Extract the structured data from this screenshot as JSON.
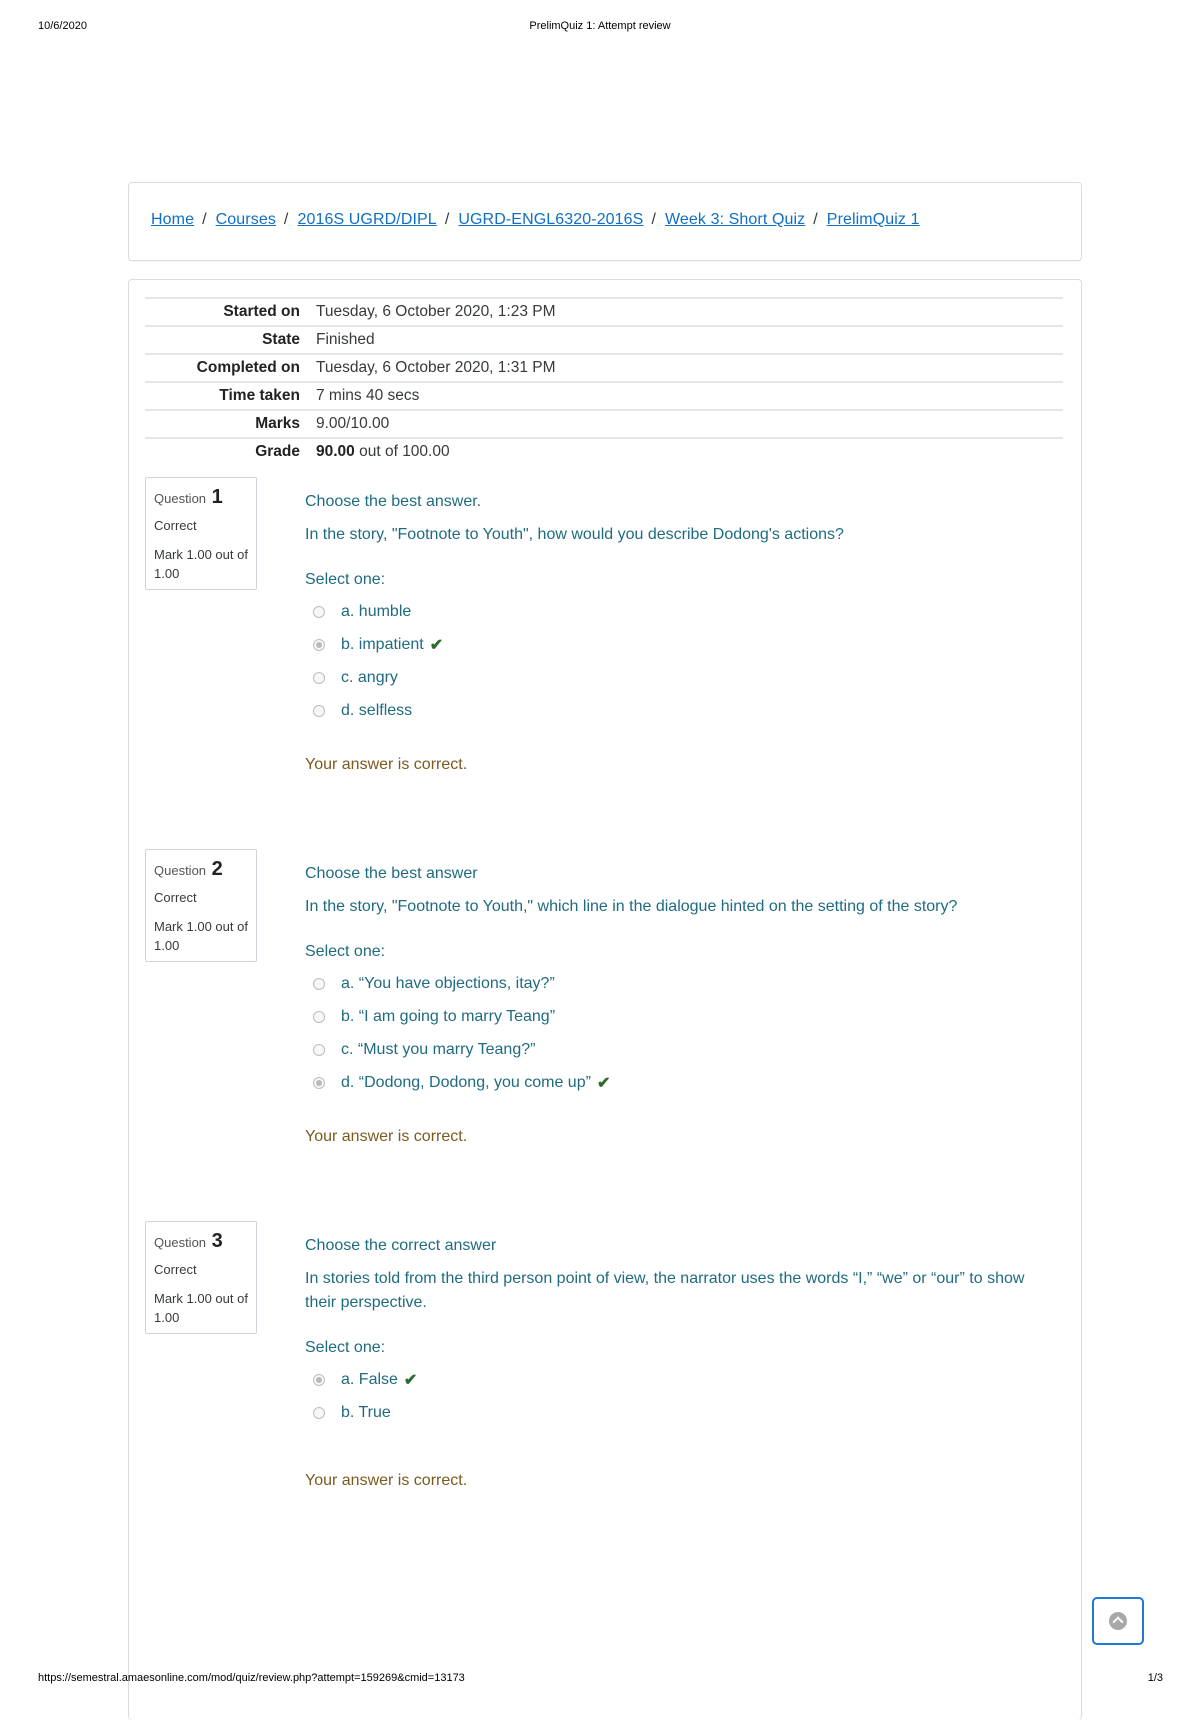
{
  "print_header": {
    "date": "10/6/2020",
    "title": "PrelimQuiz 1: Attempt review"
  },
  "print_footer": {
    "url": "https://semestral.amaesonline.com/mod/quiz/review.php?attempt=159269&cmid=13173",
    "page": "1/3"
  },
  "breadcrumb": {
    "separator": "/",
    "items": [
      {
        "label": "Home"
      },
      {
        "label": "Courses"
      },
      {
        "label": "2016S UGRD/DIPL"
      },
      {
        "label": "UGRD-ENGL6320-2016S"
      },
      {
        "label": "Week 3: Short Quiz"
      },
      {
        "label": "PrelimQuiz 1"
      }
    ]
  },
  "summary": {
    "rows": [
      {
        "label": "Started on",
        "value": "Tuesday, 6 October 2020, 1:23 PM"
      },
      {
        "label": "State",
        "value": "Finished"
      },
      {
        "label": "Completed on",
        "value": "Tuesday, 6 October 2020, 1:31 PM"
      },
      {
        "label": "Time taken",
        "value": "7 mins 40 secs"
      },
      {
        "label": "Marks",
        "value": "9.00/10.00"
      },
      {
        "label": "Grade",
        "value_bold": "90.00",
        "value": " out of 100.00"
      }
    ]
  },
  "questions": [
    {
      "label": "Question",
      "number": "1",
      "state": "Correct",
      "mark": "Mark 1.00 out of 1.00",
      "instruction": "Choose the best answer.",
      "text": "In the story, \"Footnote to Youth\", how would you describe Dodong's actions?",
      "prompt": "Select one:",
      "options": [
        {
          "label": "a. humble",
          "selected": false,
          "correct": false
        },
        {
          "label": "b. impatient",
          "selected": true,
          "correct": true
        },
        {
          "label": "c. angry",
          "selected": false,
          "correct": false
        },
        {
          "label": "d. selfless",
          "selected": false,
          "correct": false
        }
      ],
      "feedback": "Your answer is correct."
    },
    {
      "label": "Question",
      "number": "2",
      "state": "Correct",
      "mark": "Mark 1.00 out of 1.00",
      "instruction": "Choose the best answer",
      "text": "In the story, \"Footnote to Youth,\" which line in the dialogue hinted on the setting of the story?",
      "prompt": "Select one:",
      "options": [
        {
          "label": "a. “You have objections, itay?”",
          "selected": false,
          "correct": false
        },
        {
          "label": "b. “I am going to marry Teang”",
          "selected": false,
          "correct": false
        },
        {
          "label": "c. “Must you marry Teang?”",
          "selected": false,
          "correct": false
        },
        {
          "label": "d. “Dodong, Dodong, you come up”",
          "selected": true,
          "correct": true
        }
      ],
      "feedback": "Your answer is correct."
    },
    {
      "label": "Question",
      "number": "3",
      "state": "Correct",
      "mark": "Mark 1.00 out of 1.00",
      "instruction": "Choose the correct answer",
      "text": "In stories told from the third person point of view, the narrator uses the words “I,” “we” or “our” to show their perspective.",
      "prompt": "Select one:",
      "options": [
        {
          "label": "a. False",
          "selected": true,
          "correct": true
        },
        {
          "label": "b. True",
          "selected": false,
          "correct": false
        }
      ],
      "feedback": "Your answer is correct."
    }
  ],
  "icons": {
    "correct": "check-mark-icon",
    "scroll_top": "chevron-up-circle-icon"
  },
  "colors": {
    "link": "#0f6fc5",
    "question_text": "#1f6b80",
    "feedback": "#7b5a1f",
    "check": "#2f6b2f",
    "scroll_button_border": "#1f7ad6"
  }
}
